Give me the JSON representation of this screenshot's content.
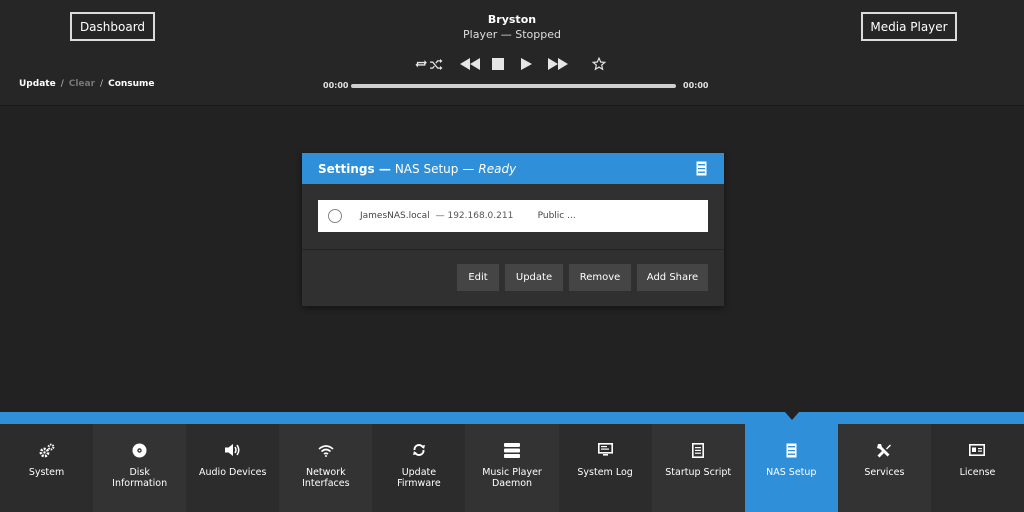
{
  "header": {
    "dashboard_label": "Dashboard",
    "media_player_label": "Media Player",
    "device_name": "Bryston",
    "player_status": "Player — Stopped",
    "time_elapsed": "00:00",
    "time_total": "00:00",
    "progress": 0,
    "breadcrumb": {
      "update": "Update",
      "sep": "/",
      "clear": "Clear",
      "consume": "Consume"
    },
    "controls": {
      "repeat": "repeat-icon",
      "shuffle": "shuffle-icon",
      "previous": "rewind-icon",
      "stop": "stop-icon",
      "play": "play-icon",
      "next": "fast-forward-icon",
      "favorite": "star-icon"
    }
  },
  "panel": {
    "title_bold": "Settings —",
    "title_section": "NAS Setup",
    "title_dash": "—",
    "title_status": "Ready",
    "header_icon": "drive-icon",
    "nas_entries": [
      {
        "host": "JamesNAS.local",
        "ip": "— 192.168.0.211",
        "share": "Public ..."
      }
    ],
    "actions": {
      "edit": "Edit",
      "update": "Update",
      "remove": "Remove",
      "add_share": "Add Share"
    }
  },
  "nav": {
    "items": [
      {
        "label": "System",
        "icon": "gears-icon",
        "active": false
      },
      {
        "label": "Disk\nInformation",
        "icon": "disc-icon",
        "active": false
      },
      {
        "label": "Audio Devices",
        "icon": "speaker-icon",
        "active": false
      },
      {
        "label": "Network\nInterfaces",
        "icon": "wifi-icon",
        "active": false
      },
      {
        "label": "Update\nFirmware",
        "icon": "refresh-icon",
        "active": false
      },
      {
        "label": "Music Player\nDaemon",
        "icon": "database-icon",
        "active": false
      },
      {
        "label": "System Log",
        "icon": "monitor-icon",
        "active": false
      },
      {
        "label": "Startup Script",
        "icon": "document-icon",
        "active": false
      },
      {
        "label": "NAS Setup",
        "icon": "drive-icon",
        "active": true
      },
      {
        "label": "Services",
        "icon": "tools-icon",
        "active": false
      },
      {
        "label": "License",
        "icon": "id-card-icon",
        "active": false
      }
    ]
  },
  "colors": {
    "accent": "#2f8fd9",
    "background": "#222222",
    "header_background": "#262626",
    "panel_background": "#303030",
    "button_background": "#454545"
  }
}
